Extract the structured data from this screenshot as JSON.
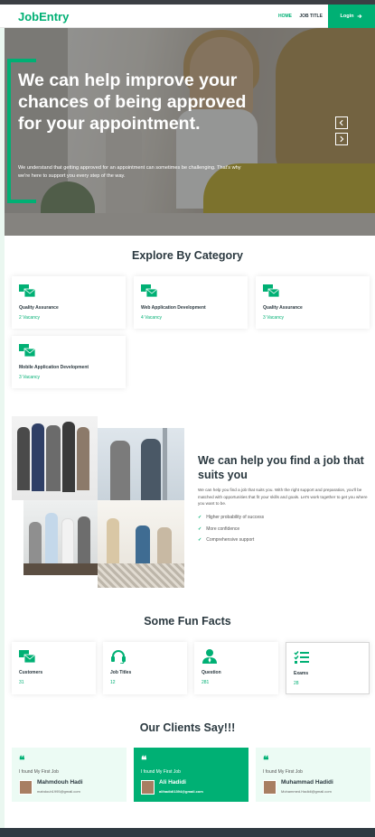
{
  "brand": {
    "name": "JobEntry",
    "accent": "#00b074"
  },
  "nav": {
    "links": [
      "HOME",
      "JOB TITLE"
    ],
    "login": {
      "label": "Login",
      "icon": "arrow-right-icon"
    }
  },
  "hero": {
    "title": "We can help improve your chances of being approved for your appointment.",
    "subtitle": "We understand that getting approved for an appointment can sometimes be challenging. That's why we're here to support you every step of the way.",
    "prev_icon": "chevron-left-icon",
    "next_icon": "chevron-right-icon"
  },
  "categories": {
    "title": "Explore By Category",
    "items": [
      {
        "name": "Quality Assurance",
        "count": "2 Vacancy",
        "icon": "mail-bulk-icon"
      },
      {
        "name": "Web Application Development",
        "count": "4 Vacancy",
        "icon": "mail-bulk-icon"
      },
      {
        "name": "Quality Assurance",
        "count": "3 Vacancy",
        "icon": "mail-bulk-icon"
      },
      {
        "name": "Mobile Application Development",
        "count": "3 Vacancy",
        "icon": "mail-bulk-icon"
      }
    ]
  },
  "about": {
    "title": "We can help you find a job that suits you",
    "text": "We can help you find a job that suits you. With the right support and preparation, you'll be matched with opportunities that fit your skills and goals. Let's work together to get you where you want to be.",
    "points": [
      "Higher probability of success",
      "More confidence",
      "Comprehensive support"
    ]
  },
  "facts": {
    "title": "Some Fun Facts",
    "items": [
      {
        "label": "Customers",
        "value": "31",
        "icon": "mail-bulk-icon"
      },
      {
        "label": "Job Titles",
        "value": "12",
        "icon": "headset-icon"
      },
      {
        "label": "Question",
        "value": "281",
        "icon": "user-tie-icon"
      },
      {
        "label": "Exams",
        "value": "28",
        "icon": "tasks-icon"
      }
    ]
  },
  "clients": {
    "title": "Our Clients Say!!!",
    "items": [
      {
        "quote_icon": "quote-left-icon",
        "said": "I found My First Job",
        "name": "Mahmdouh Hadi",
        "email": "mahdouh1995@gmail.com"
      },
      {
        "quote_icon": "quote-left-icon",
        "said": "I found My First Job",
        "name": "Ali Hadidi",
        "email": "alihadidi1394@gmail.com"
      },
      {
        "quote_icon": "quote-left-icon",
        "said": "I found My First Job",
        "name": "Muhammad Hadidi",
        "email": "Mohammed.Hadidi@gmail.com"
      }
    ]
  }
}
